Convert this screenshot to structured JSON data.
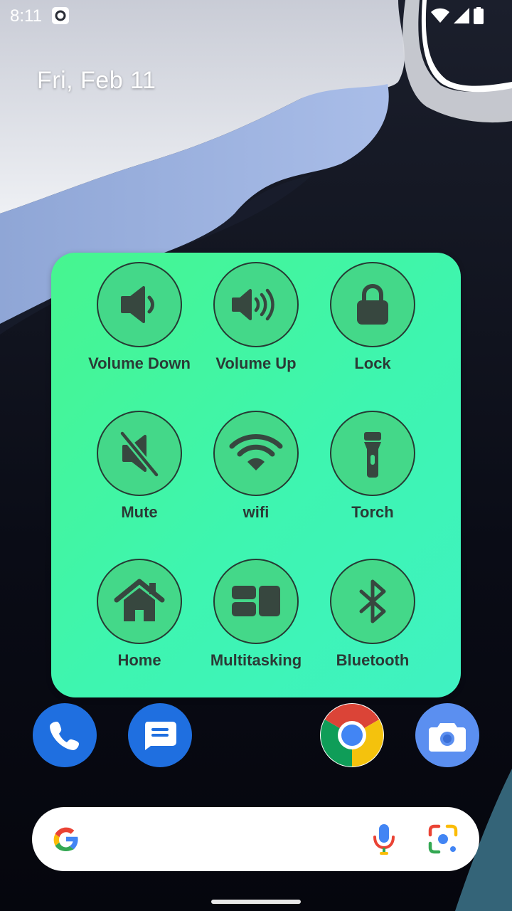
{
  "status_bar": {
    "time": "8:11",
    "icons": [
      "screen-record-icon",
      "wifi-signal-icon",
      "cell-signal-icon",
      "battery-icon"
    ]
  },
  "home": {
    "date": "Fri, Feb 11"
  },
  "widget": {
    "background_colors": [
      "#47f58f",
      "#3ff2c2"
    ],
    "tiles": [
      {
        "label": "Volume Down",
        "icon": "volume-down-icon"
      },
      {
        "label": "Volume Up",
        "icon": "volume-up-icon"
      },
      {
        "label": "Lock",
        "icon": "lock-icon"
      },
      {
        "label": "Mute",
        "icon": "mute-icon"
      },
      {
        "label": "wifi",
        "icon": "wifi-icon"
      },
      {
        "label": "Torch",
        "icon": "torch-icon"
      },
      {
        "label": "Home",
        "icon": "home-icon"
      },
      {
        "label": "Multitasking",
        "icon": "multitasking-icon"
      },
      {
        "label": "Bluetooth",
        "icon": "bluetooth-icon"
      }
    ]
  },
  "dock": {
    "apps": [
      "phone-icon",
      "messages-icon",
      "chrome-icon",
      "camera-icon"
    ]
  },
  "search": {
    "icons": [
      "google-g-icon",
      "microphone-icon",
      "lens-icon"
    ]
  }
}
